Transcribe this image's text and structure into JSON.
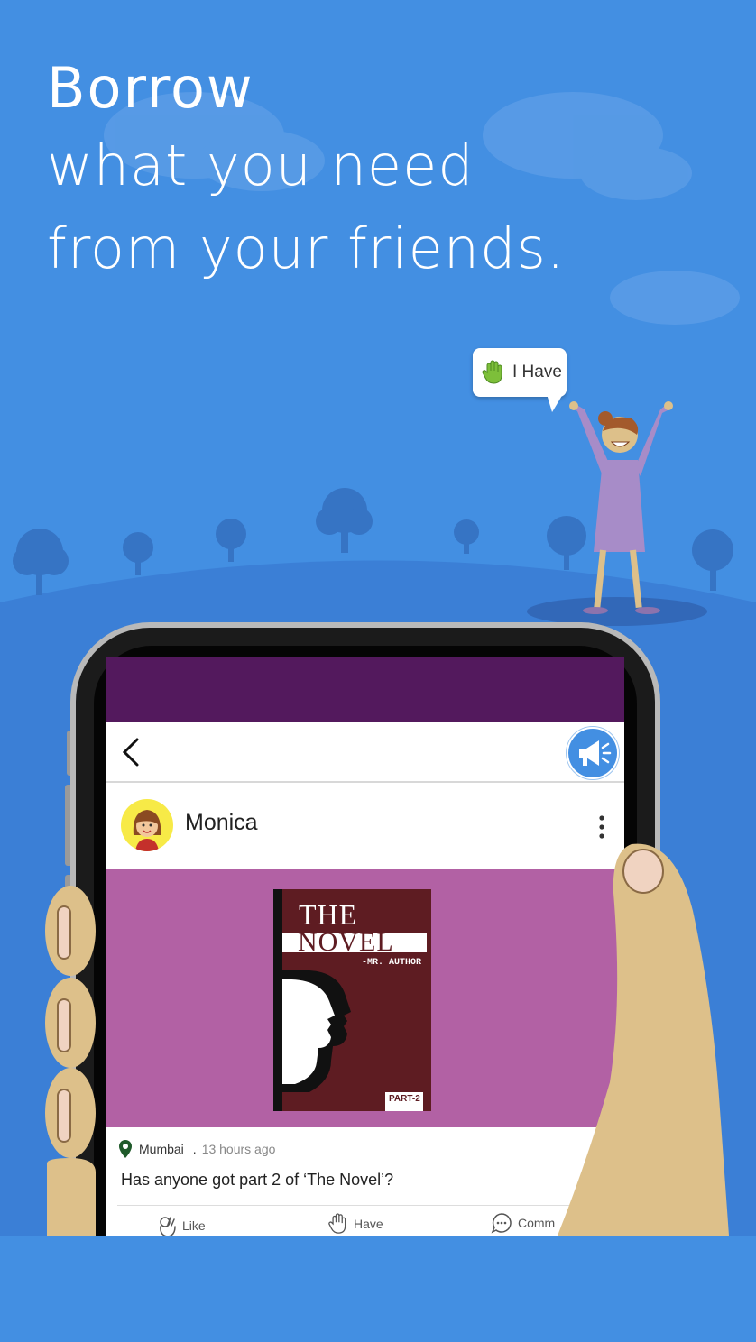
{
  "headline": {
    "line1": "Borrow",
    "line2": "what you need",
    "line3": "from your friends."
  },
  "bubble": {
    "label": "I Have",
    "icon": "raised-hand-icon"
  },
  "app": {
    "post": {
      "user": "Monica",
      "location": "Mumbai",
      "separator": ".",
      "time": "13 hours ago",
      "text": "Has anyone got part 2 of ‘The Novel’?",
      "book": {
        "line1": "THE",
        "line2": "NOVEL",
        "author": "-MR. AUTHOR",
        "part": "PART-2"
      }
    },
    "actions": [
      {
        "label": "Like",
        "icon": "ok-hand-icon"
      },
      {
        "label": "Have",
        "icon": "raised-hand-icon"
      },
      {
        "label": "Comm",
        "icon": "comment-icon"
      }
    ]
  },
  "colors": {
    "sky": "#438fe2",
    "hill": "#3b7fd6",
    "status_bar": "#53195d",
    "post_image_bg": "#b261a4",
    "book_cover": "#5e1c22",
    "accent_button": "#438fe2",
    "skin": "#ddc08a",
    "dress": "#a78cc8"
  }
}
